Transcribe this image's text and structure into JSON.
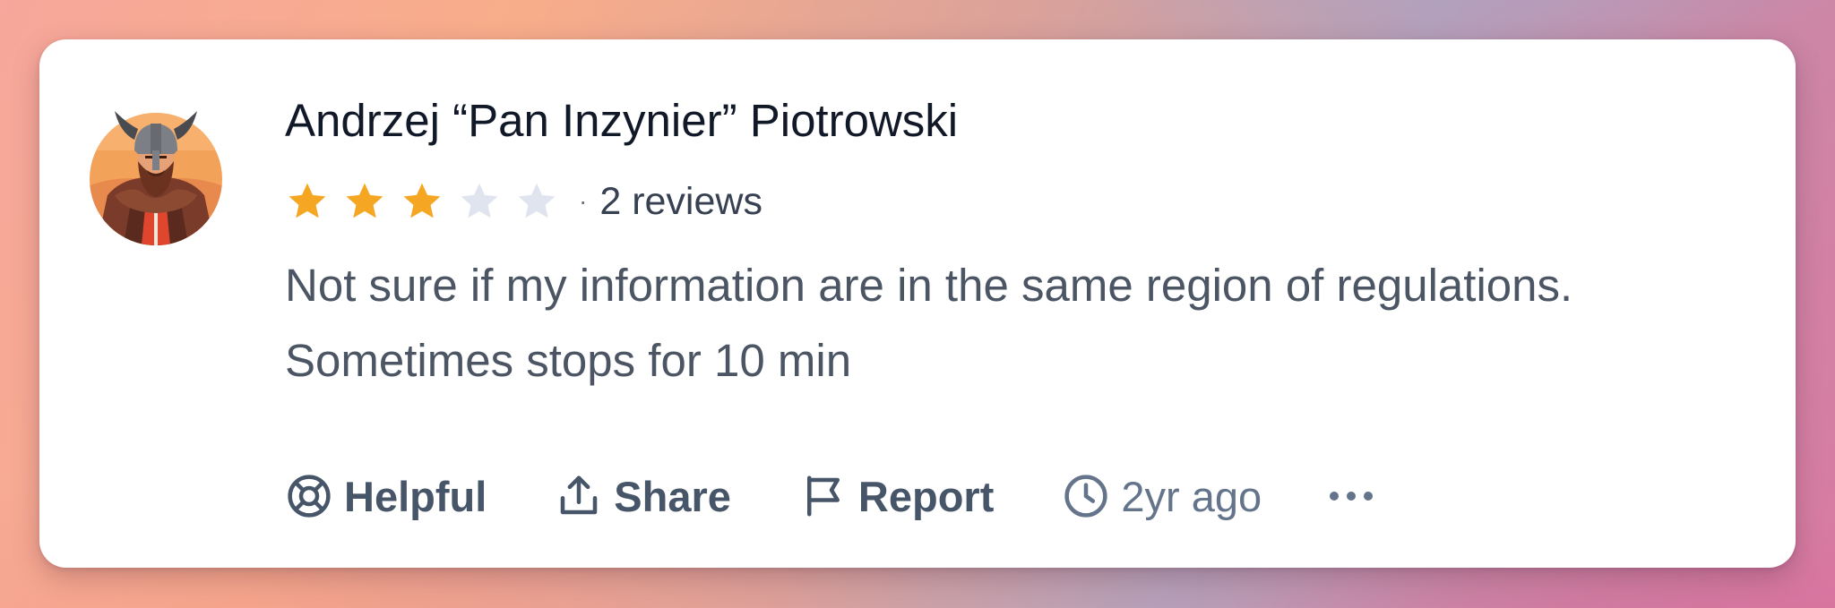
{
  "review": {
    "author_name": "Andrzej “Pan Inzynier” Piotrowski",
    "rating": 3,
    "max_rating": 5,
    "separator": "·",
    "review_count": "2 reviews",
    "text": "Not sure if my information are in the same region of regulations. Sometimes stops for 10 min",
    "avatar_icon": "viking-avatar-icon"
  },
  "actions": {
    "helpful_label": "Helpful",
    "share_label": "Share",
    "report_label": "Report",
    "time_label": "2yr ago"
  },
  "colors": {
    "star_filled": "#f5a623",
    "star_empty": "#dfe4ee",
    "text_primary": "#111827",
    "text_secondary": "#4b5563",
    "action": "#475569"
  }
}
